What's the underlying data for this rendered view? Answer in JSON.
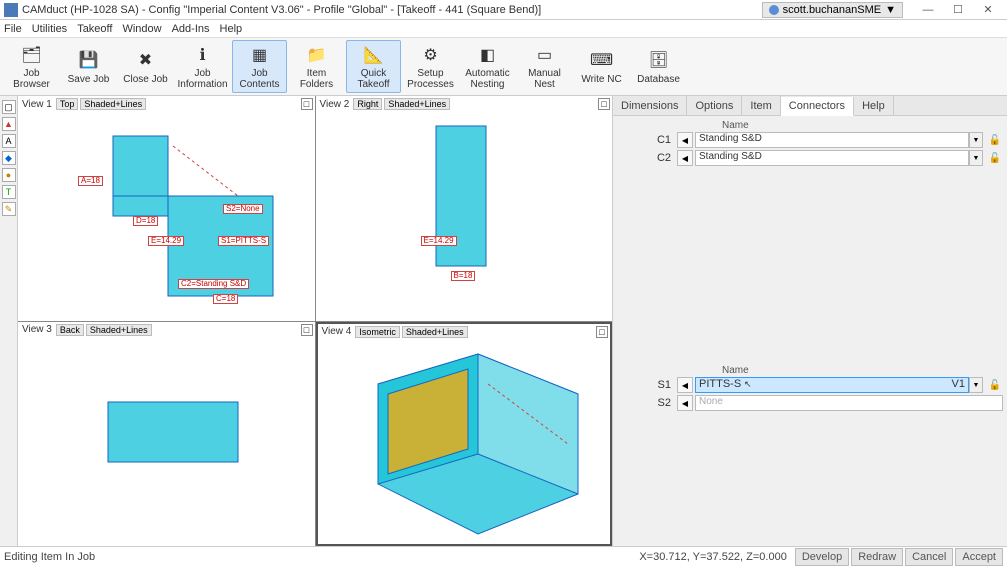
{
  "title": "CAMduct (HP-1028 SA) - Config \"Imperial Content V3.06\" - Profile \"Global\" - [Takeoff - 441 (Square Bend)]",
  "user": "scott.buchananSME",
  "menus": [
    "File",
    "Utilities",
    "Takeoff",
    "Window",
    "Add-Ins",
    "Help"
  ],
  "toolbar": [
    {
      "label": "Job Browser"
    },
    {
      "label": "Save Job"
    },
    {
      "label": "Close Job"
    },
    {
      "label": "Job Information"
    },
    {
      "label": "Job Contents"
    },
    {
      "label": "Item Folders"
    },
    {
      "label": "Quick Takeoff"
    },
    {
      "label": "Setup Processes"
    },
    {
      "label": "Automatic Nesting"
    },
    {
      "label": "Manual Nest"
    },
    {
      "label": "Write NC"
    },
    {
      "label": "Database"
    }
  ],
  "views": {
    "v1": {
      "name": "View 1",
      "mode1": "Top",
      "mode2": "Shaded+Lines"
    },
    "v2": {
      "name": "View 2",
      "mode1": "Right",
      "mode2": "Shaded+Lines"
    },
    "v3": {
      "name": "View 3",
      "mode1": "Back",
      "mode2": "Shaded+Lines"
    },
    "v4": {
      "name": "View 4",
      "mode1": "Isometric",
      "mode2": "Shaded+Lines"
    }
  },
  "dims": {
    "A": "A=18",
    "D": "D=18",
    "E": "E=14.29",
    "S2": "S2=None",
    "S1": "S1=PITTS-S",
    "C2": "C2=Standing S&D",
    "C": "C=18",
    "B": "B=18",
    "E2": "E=14.29"
  },
  "rp": {
    "tabs": [
      "Dimensions",
      "Options",
      "Item",
      "Connectors",
      "Help"
    ],
    "name_header": "Name",
    "c_rows": [
      {
        "label": "C1",
        "value": "Standing S&D"
      },
      {
        "label": "C2",
        "value": "Standing S&D"
      }
    ],
    "s_rows": [
      {
        "label": "S1",
        "value": "PITTS-S",
        "extra": "V1",
        "selected": true
      },
      {
        "label": "S2",
        "value": "None",
        "placeholder": true
      }
    ]
  },
  "status": {
    "text": "Editing Item In Job",
    "coords": "X=30.712, Y=37.522, Z=0.000",
    "buttons": [
      "Develop",
      "Redraw",
      "Cancel",
      "Accept"
    ]
  }
}
